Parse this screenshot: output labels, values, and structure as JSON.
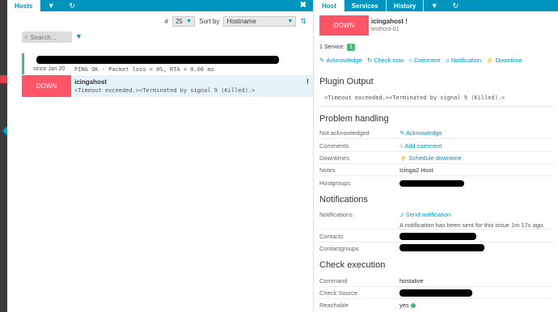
{
  "left_tabs": {
    "hosts": "Hosts",
    "chevron_icon": "chevron-down-icon",
    "refresh_icon": "refresh-icon",
    "close": "✖"
  },
  "right_tabs": {
    "host": "Host",
    "services": "Services",
    "history": "History",
    "chevron_icon": "chevron-down-icon",
    "refresh_icon": "refresh-icon"
  },
  "controls": {
    "limit_label": "#",
    "limit_value": "25",
    "sort_label": "Sort by",
    "sort_value": "Hostname"
  },
  "search": {
    "placeholder": "Search..."
  },
  "hosts_list": [
    {
      "since": "since Jan 20",
      "output": "PING OK - Packet loss = 0%, RTA = 0.06 ms",
      "status_color": "#44bb77"
    },
    {
      "state": "DOWN",
      "name": "icingahost",
      "flag": "!",
      "output": "<Timeout exceeded.><Terminated by signal 9 (Killed).>"
    }
  ],
  "detail": {
    "state": "DOWN",
    "host_name": "icingahost",
    "flag": "!",
    "host_sub": "testhost-01",
    "services_label": "1 Service:",
    "services_count": "1",
    "actions": [
      "Acknowledge",
      "Check now",
      "Comment",
      "Notification",
      "Downtime"
    ],
    "plugin_output_title": "Plugin Output",
    "plugin_output": "<Timeout exceeded.><Terminated by signal 9 (Killed).>",
    "problem_title": "Problem handling",
    "problem": {
      "ack_label": "Not acknowledged",
      "ack_value": "Acknowledge",
      "comments_label": "Comments",
      "comments_value": "Add comment",
      "downtimes_label": "Downtimes",
      "downtimes_value": "Schedule downtime",
      "notes_label": "Notes",
      "notes_value": "Icinga2 Host",
      "hostgroups_label": "Hostgroups"
    },
    "notifications_title": "Notifications",
    "notifications": {
      "label": "Notifications",
      "send": "Send notification",
      "note": "A notification has been sent for this issue 1m 17s ago.",
      "contacts_label": "Contacts",
      "contactgroups_label": "Contactgroups"
    },
    "check_title": "Check execution",
    "check": {
      "command_label": "Command",
      "command_value": "hostalive",
      "source_label": "Check Source",
      "reachable_label": "Reachable",
      "reachable_value": "yes"
    }
  },
  "colors": {
    "accent": "#0095bf",
    "down": "#ff5566",
    "ok": "#44bb77"
  }
}
